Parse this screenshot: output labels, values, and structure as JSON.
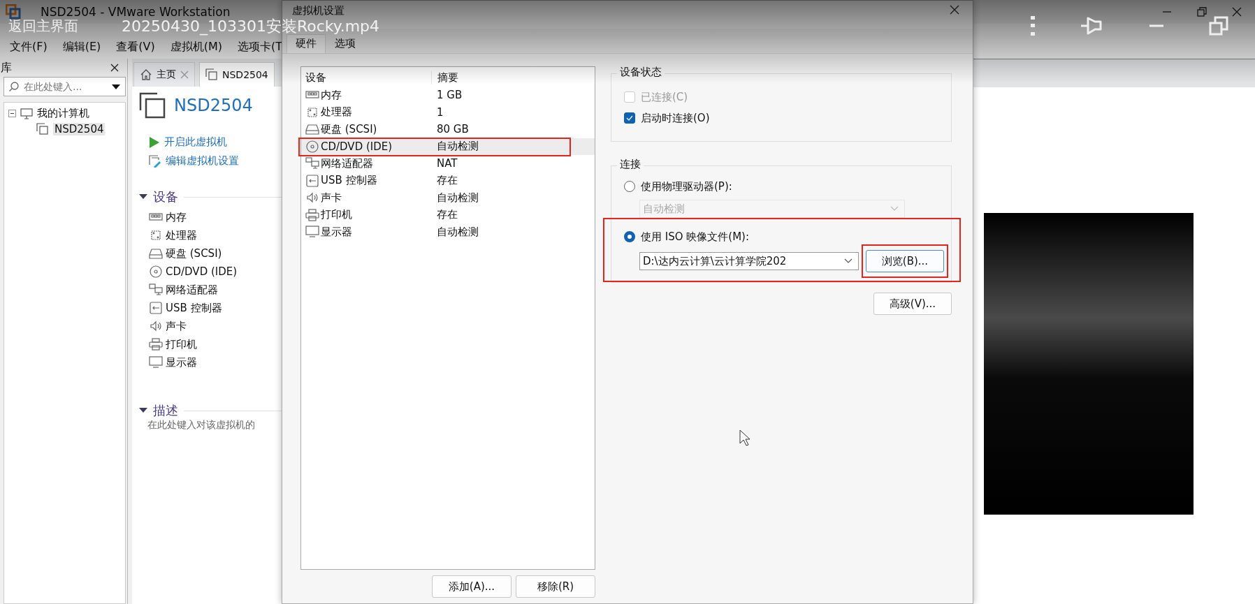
{
  "video_overlay": {
    "back_label": "返回主界面",
    "file_name": "20250430_103301安装Rocky.mp4"
  },
  "window": {
    "title": "NSD2504 - VMware Workstation"
  },
  "menu": [
    "文件(F)",
    "编辑(E)",
    "查看(V)",
    "虚拟机(M)",
    "选项卡(T"
  ],
  "library": {
    "title": "库",
    "search": {
      "placeholder": "在此处键入..."
    },
    "tree": [
      {
        "label": "我的计算机",
        "expanded": true,
        "children": [
          {
            "label": "NSD2504",
            "selected": true
          }
        ]
      }
    ]
  },
  "tabs": [
    {
      "label": "主页",
      "kind": "home",
      "selected": false
    },
    {
      "label": "NSD2504",
      "kind": "vm",
      "selected": true
    }
  ],
  "vm": {
    "name": "NSD2504",
    "actions": [
      {
        "label": "开启此虚拟机",
        "kind": "play"
      },
      {
        "label": "编辑虚拟机设置",
        "kind": "edit"
      }
    ],
    "devices_heading": "设备",
    "devices": [
      {
        "label": "内存",
        "kind": "memory"
      },
      {
        "label": "处理器",
        "kind": "cpu"
      },
      {
        "label": "硬盘 (SCSI)",
        "kind": "disk"
      },
      {
        "label": "CD/DVD (IDE)",
        "kind": "cd"
      },
      {
        "label": "网络适配器",
        "kind": "network"
      },
      {
        "label": "USB 控制器",
        "kind": "usb"
      },
      {
        "label": "声卡",
        "kind": "sound"
      },
      {
        "label": "打印机",
        "kind": "printer"
      },
      {
        "label": "显示器",
        "kind": "display"
      }
    ],
    "description_heading": "描述",
    "description_placeholder": "在此处键入对该虚拟机的"
  },
  "dialog": {
    "title": "虚拟机设置",
    "tabs": [
      {
        "label": "硬件",
        "selected": true
      },
      {
        "label": "选项",
        "selected": false
      }
    ],
    "device_table": {
      "columns": [
        "设备",
        "摘要"
      ],
      "rows": [
        {
          "device": "内存",
          "summary": "1 GB",
          "kind": "memory",
          "selected": false,
          "highlighted": false
        },
        {
          "device": "处理器",
          "summary": "1",
          "kind": "cpu",
          "selected": false,
          "highlighted": false
        },
        {
          "device": "硬盘 (SCSI)",
          "summary": "80 GB",
          "kind": "disk",
          "selected": false,
          "highlighted": false
        },
        {
          "device": "CD/DVD (IDE)",
          "summary": "自动检测",
          "kind": "cd",
          "selected": true,
          "highlighted": true
        },
        {
          "device": "网络适配器",
          "summary": "NAT",
          "kind": "network",
          "selected": false,
          "highlighted": false
        },
        {
          "device": "USB 控制器",
          "summary": "存在",
          "kind": "usb",
          "selected": false,
          "highlighted": false
        },
        {
          "device": "声卡",
          "summary": "自动检测",
          "kind": "sound",
          "selected": false,
          "highlighted": false
        },
        {
          "device": "打印机",
          "summary": "存在",
          "kind": "printer",
          "selected": false,
          "highlighted": false
        },
        {
          "device": "显示器",
          "summary": "自动检测",
          "kind": "display",
          "selected": false,
          "highlighted": false
        }
      ]
    },
    "buttons": [
      "添加(A)...",
      "移除(R)"
    ],
    "device_status": {
      "title": "设备状态",
      "options": [
        {
          "label": "已连接(C)",
          "checked": false,
          "disabled": true
        },
        {
          "label": "启动时连接(O)",
          "checked": true,
          "disabled": false
        }
      ]
    },
    "connection": {
      "title": "连接",
      "options": [
        {
          "label": "使用物理驱动器(P):",
          "selected": false,
          "highlighted": false,
          "dropdown": {
            "value": "自动检测",
            "disabled": true
          }
        },
        {
          "label": "使用 ISO 映像文件(M):",
          "selected": true,
          "highlighted": true,
          "dropdown": {
            "value": "D:\\达内云计算\\云计算学院202",
            "disabled": false
          },
          "button": {
            "label": "浏览(B)...",
            "highlighted": true
          }
        }
      ],
      "advanced_button": "高级(V)..."
    }
  }
}
